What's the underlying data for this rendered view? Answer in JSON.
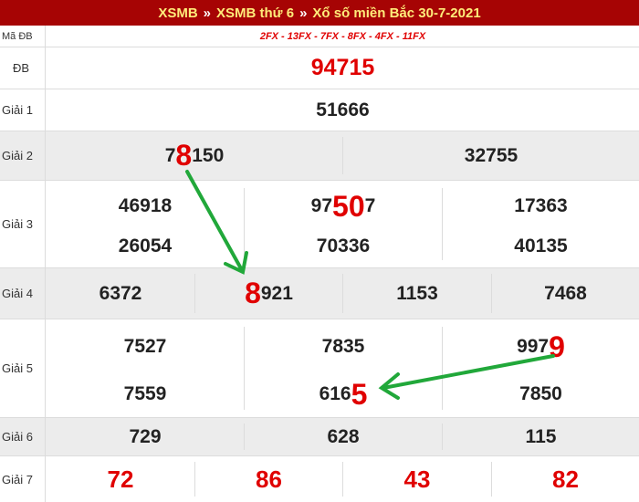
{
  "header": {
    "link1": "XSMB",
    "sep1": "»",
    "link2": "XSMB thứ 6",
    "sep2": "»",
    "link3": "Xổ số miền Bắc 30-7-2021"
  },
  "labels": {
    "ma_db": "Mã ĐB",
    "db": "ĐB",
    "g1": "Giải 1",
    "g2": "Giải 2",
    "g3": "Giải 3",
    "g4": "Giải 4",
    "g5": "Giải 5",
    "g6": "Giải 6",
    "g7": "Giải 7"
  },
  "results": {
    "ma_db": "2FX - 13FX - 7FX - 8FX - 4FX - 11FX",
    "db": "94715",
    "g1": "51666",
    "g2": [
      {
        "pre": "7",
        "hl": "8",
        "post": "150"
      },
      {
        "pre": "32755",
        "hl": "",
        "post": ""
      }
    ],
    "g3": [
      {
        "pre": "46918",
        "hl": "",
        "post": ""
      },
      {
        "pre": "97",
        "hl": "50",
        "post": "7"
      },
      {
        "pre": "17363",
        "hl": "",
        "post": ""
      },
      {
        "pre": "26054",
        "hl": "",
        "post": ""
      },
      {
        "pre": "70336",
        "hl": "",
        "post": ""
      },
      {
        "pre": "40135",
        "hl": "",
        "post": ""
      }
    ],
    "g4": [
      {
        "pre": "6372",
        "hl": "",
        "post": ""
      },
      {
        "pre": "",
        "hl": "8",
        "post": "921"
      },
      {
        "pre": "1153",
        "hl": "",
        "post": ""
      },
      {
        "pre": "7468",
        "hl": "",
        "post": ""
      }
    ],
    "g5": [
      {
        "pre": "7527",
        "hl": "",
        "post": ""
      },
      {
        "pre": "7835",
        "hl": "",
        "post": ""
      },
      {
        "pre": "997",
        "hl": "9",
        "post": ""
      },
      {
        "pre": "7559",
        "hl": "",
        "post": ""
      },
      {
        "pre": "616",
        "hl": "5",
        "post": ""
      },
      {
        "pre": "7850",
        "hl": "",
        "post": ""
      }
    ],
    "g6": [
      "729",
      "628",
      "115"
    ],
    "g7": [
      "72",
      "86",
      "43",
      "82"
    ]
  },
  "colors": {
    "header_bg": "#a60404",
    "header_text": "#ffec7a",
    "highlight": "#e00000",
    "arrow": "#21a83a"
  }
}
